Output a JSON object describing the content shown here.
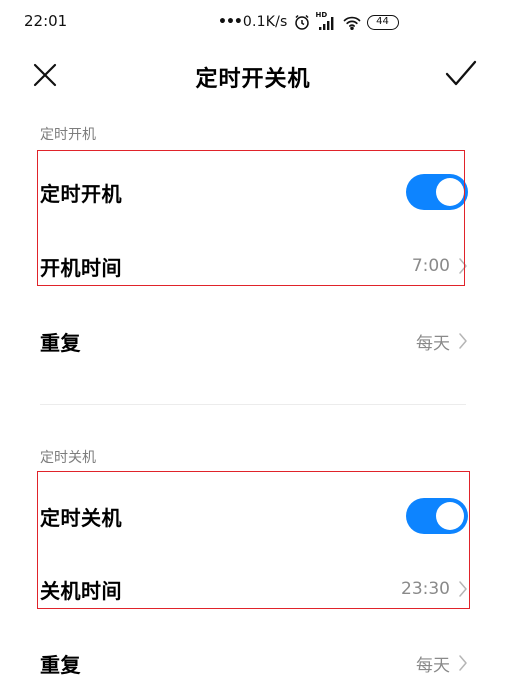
{
  "status_bar": {
    "time": "22:01",
    "dots": "•••",
    "network_speed": "0.1K/s",
    "hd_label": "HD",
    "battery_level": "44",
    "icons": [
      "alarm-icon",
      "signal-icon",
      "wifi-icon",
      "battery-icon"
    ]
  },
  "title_bar": {
    "title": "定时开关机",
    "close_icon": "close-icon",
    "confirm_icon": "check-icon"
  },
  "power_on_section": {
    "header": "定时开机",
    "toggle_row": {
      "label": "定时开机",
      "enabled": true
    },
    "time_row": {
      "label": "开机时间",
      "value": "7:00"
    },
    "repeat_row": {
      "label": "重复",
      "value": "每天"
    }
  },
  "power_off_section": {
    "header": "定时关机",
    "toggle_row": {
      "label": "定时关机",
      "enabled": true
    },
    "time_row": {
      "label": "关机时间",
      "value": "23:30"
    },
    "repeat_row": {
      "label": "重复",
      "value": "每天"
    }
  },
  "colors": {
    "toggle_on": "#0d84ff",
    "highlight_border": "#e0232a",
    "secondary_text": "#8a8a8a"
  }
}
